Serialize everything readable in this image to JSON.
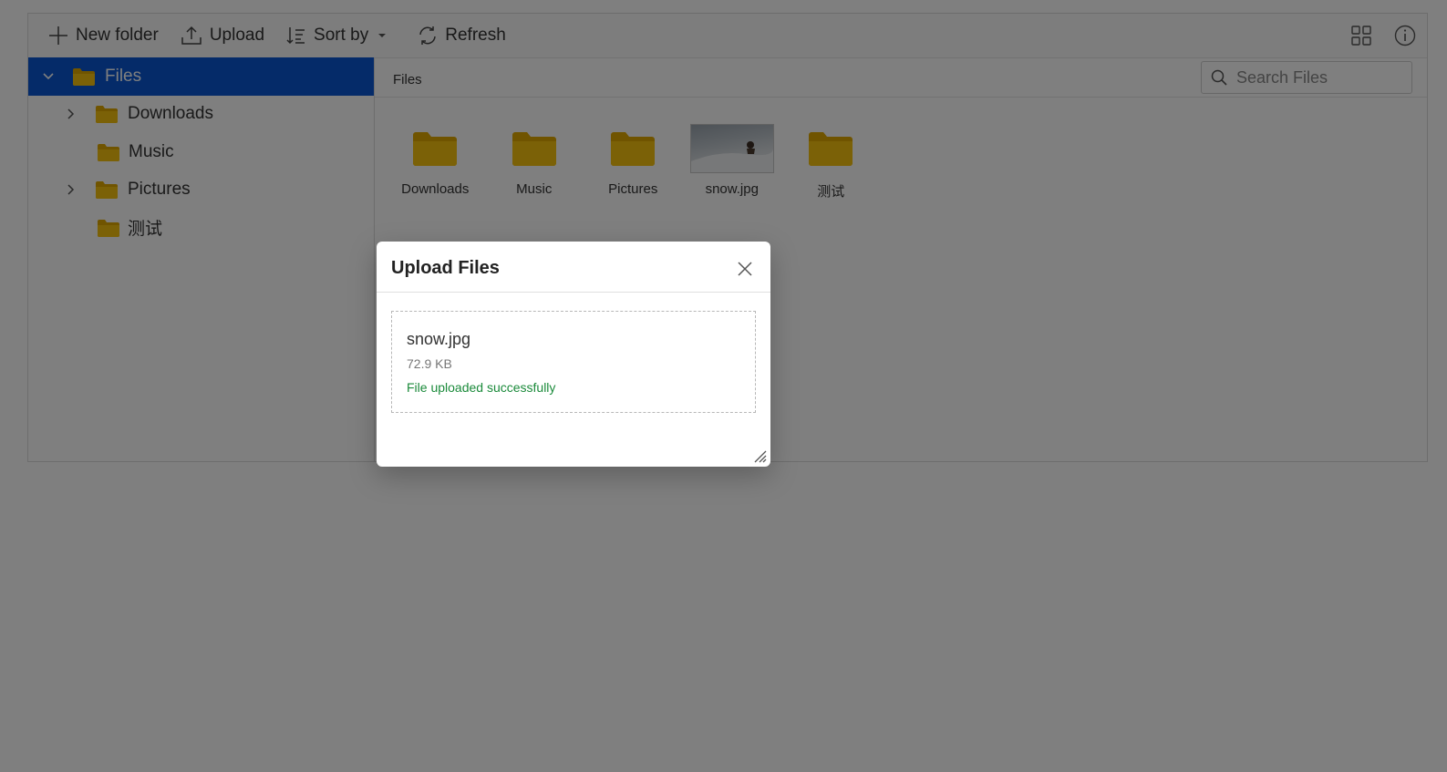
{
  "toolbar": {
    "new_folder": "New folder",
    "upload": "Upload",
    "sort_by": "Sort by",
    "refresh": "Refresh"
  },
  "tree": {
    "root": "Files",
    "items": [
      {
        "label": "Downloads",
        "expandable": true
      },
      {
        "label": "Music",
        "expandable": false
      },
      {
        "label": "Pictures",
        "expandable": true
      },
      {
        "label": "测试",
        "expandable": false
      }
    ]
  },
  "breadcrumb": "Files",
  "search": {
    "placeholder": "Search Files"
  },
  "files": [
    {
      "name": "Downloads",
      "type": "folder"
    },
    {
      "name": "Music",
      "type": "folder"
    },
    {
      "name": "Pictures",
      "type": "folder"
    },
    {
      "name": "snow.jpg",
      "type": "image"
    },
    {
      "name": "测试",
      "type": "folder"
    }
  ],
  "dialog": {
    "title": "Upload Files",
    "file_name": "snow.jpg",
    "file_size": "72.9 KB",
    "status": "File uploaded successfully"
  },
  "colors": {
    "selected": "#0a57d3",
    "folder": "#f7c20e",
    "success": "#1a8a3a"
  }
}
